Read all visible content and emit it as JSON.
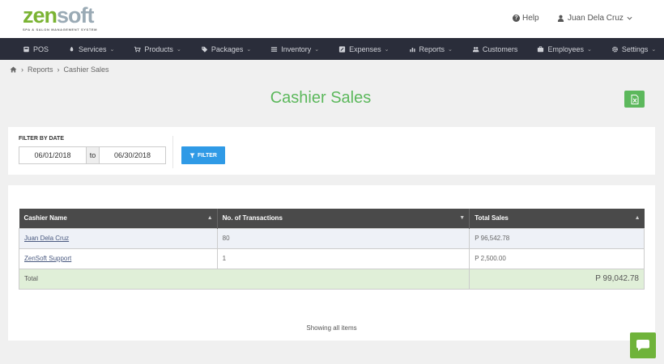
{
  "brand": {
    "zen": "ZEN",
    "soft": "SOFT",
    "tagline": "SPA & SALON MANAGEMENT SYSTEM"
  },
  "header": {
    "help": "Help",
    "user": "Juan Dela Cruz"
  },
  "nav": [
    {
      "label": "POS",
      "icon": "pos-icon",
      "dropdown": false
    },
    {
      "label": "Services",
      "icon": "services-icon",
      "dropdown": true
    },
    {
      "label": "Products",
      "icon": "cart-icon",
      "dropdown": true
    },
    {
      "label": "Packages",
      "icon": "tag-icon",
      "dropdown": true
    },
    {
      "label": "Inventory",
      "icon": "list-icon",
      "dropdown": true
    },
    {
      "label": "Expenses",
      "icon": "expenses-icon",
      "dropdown": true
    },
    {
      "label": "Reports",
      "icon": "chart-icon",
      "dropdown": true
    },
    {
      "label": "Customers",
      "icon": "users-icon",
      "dropdown": false
    },
    {
      "label": "Employees",
      "icon": "briefcase-icon",
      "dropdown": true
    },
    {
      "label": "Settings",
      "icon": "gear-icon",
      "dropdown": true
    }
  ],
  "breadcrumb": {
    "level1": "Reports",
    "level2": "Cashier Sales"
  },
  "page": {
    "title": "Cashier Sales"
  },
  "filter": {
    "label": "FILTER BY DATE",
    "from": "06/01/2018",
    "to_label": "to",
    "to": "06/30/2018",
    "button": "FILTER"
  },
  "table": {
    "headers": [
      "Cashier Name",
      "No. of Transactions",
      "Total Sales"
    ],
    "rows": [
      {
        "name": "Juan Dela Cruz",
        "transactions": "80",
        "sales": "P 96,542.78"
      },
      {
        "name": "ZenSoft Support",
        "transactions": "1",
        "sales": "P 2,500.00"
      }
    ],
    "total_label": "Total",
    "total_value": "P 99,042.78",
    "showing": "Showing all items"
  },
  "colors": {
    "accent": "#5cb85c",
    "nav_bg": "#2a2d3a",
    "filter_btn": "#2f9ae6",
    "total_row": "#e0efd8"
  }
}
